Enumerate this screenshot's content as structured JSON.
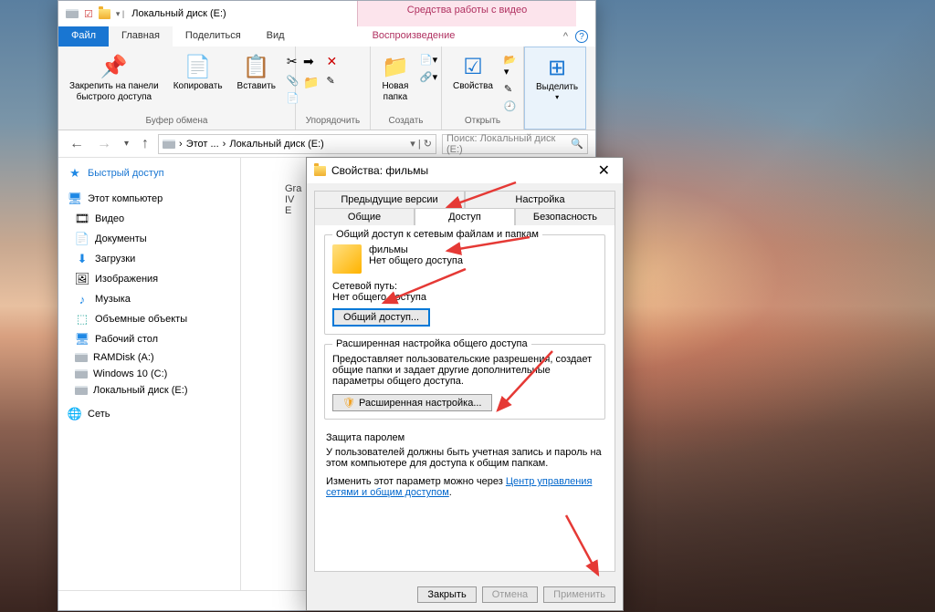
{
  "explorer": {
    "title": "Локальный диск (E:)",
    "video_tools": "Средства работы с видео",
    "tabs": {
      "file": "Файл",
      "main": "Главная",
      "share": "Поделиться",
      "view": "Вид",
      "playback": "Воспроизведение"
    },
    "ribbon": {
      "pin": "Закрепить на панели\nбыстрого доступа",
      "copy": "Копировать",
      "paste": "Вставить",
      "clipboard_group": "Буфер обмена",
      "newfolder": "Новая\nпапка",
      "organize_group": "Упорядочить",
      "create_group": "Создать",
      "properties": "Свойства",
      "open_group": "Открыть",
      "select": "Выделить"
    },
    "address": {
      "this": "Этот ...",
      "drive": "Локальный диск (E:)",
      "search_placeholder": "Поиск: Локальный диск (E:)"
    },
    "nav": {
      "quick": "Быстрый доступ",
      "thispc": "Этот компьютер",
      "items": [
        "Видео",
        "Документы",
        "Загрузки",
        "Изображения",
        "Музыка",
        "Объемные объекты",
        "Рабочий стол",
        "RAMDisk (A:)",
        "Windows 10 (C:)",
        "Локальный диск (E:)"
      ],
      "network": "Сеть"
    },
    "content_item": "Gra\nIV\nE"
  },
  "props": {
    "title": "Свойства: фильмы",
    "tabs": {
      "prev": "Предыдущие версии",
      "settings": "Настройка",
      "general": "Общие",
      "sharing": "Доступ",
      "security": "Безопасность"
    },
    "group1": {
      "title": "Общий доступ к сетевым файлам и папкам",
      "folder_name": "фильмы",
      "not_shared": "Нет общего доступа",
      "netpath_label": "Сетевой путь:",
      "netpath_value": "Нет общего доступа",
      "share_btn": "Общий доступ..."
    },
    "group2": {
      "title": "Расширенная настройка общего доступа",
      "desc": "Предоставляет пользовательские разрешения, создает общие папки и задает другие дополнительные параметры общего доступа.",
      "btn": "Расширенная настройка..."
    },
    "group3": {
      "title": "Защита паролем",
      "desc": "У пользователей должны быть учетная запись и пароль на этом компьютере для доступа к общим папкам.",
      "change_prefix": "Изменить этот параметр можно через ",
      "link": "Центр управления сетями и общим доступом"
    },
    "buttons": {
      "close": "Закрыть",
      "cancel": "Отмена",
      "apply": "Применить"
    }
  }
}
